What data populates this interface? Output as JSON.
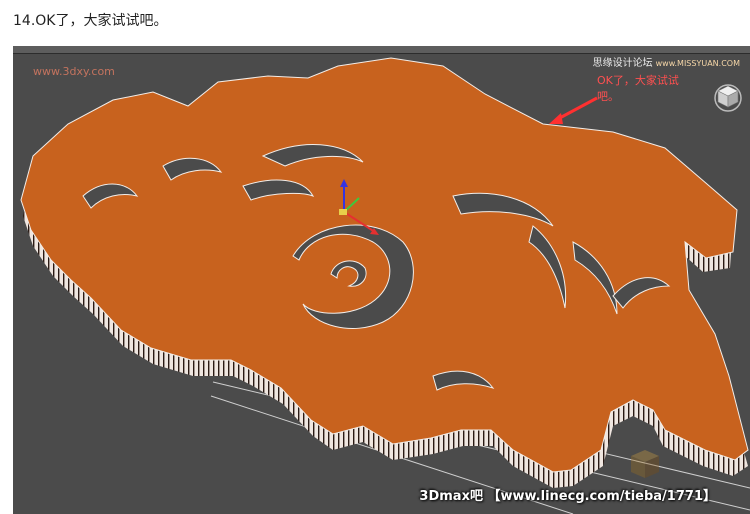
{
  "caption": "14.OK了，大家试试吧。",
  "viewport": {
    "watermark_top_left": "www.3dxy.com",
    "forum_logo": "思缘设计论坛",
    "forum_domain": "www.MISSYUAN.COM",
    "annotation": "OK了，大家试试吧。",
    "bottom_watermark": "3Dmax吧 【www.linecg.com/tieba/1771】",
    "colors": {
      "background": "#4b4b4b",
      "letter_face": "#c8621e",
      "letter_side": "#efe6e0",
      "annotation_red": "#ff4040",
      "gizmo_x": "#e53030",
      "gizmo_y": "#3ec83e",
      "gizmo_z": "#3434e0"
    }
  }
}
